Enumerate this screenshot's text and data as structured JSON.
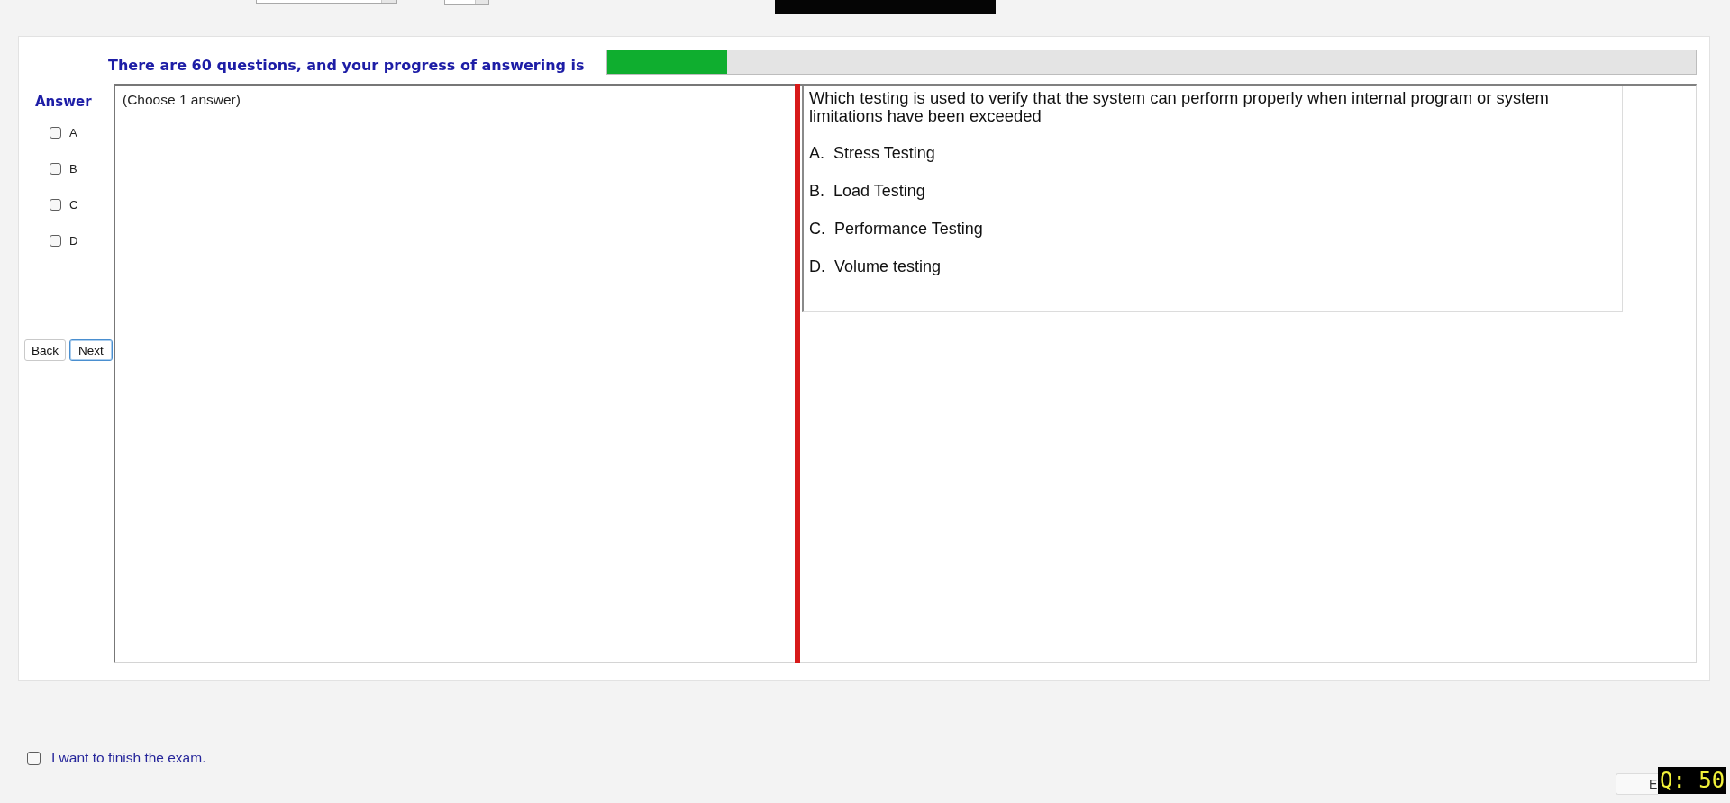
{
  "exam": {
    "progress": {
      "label": "There are 60 questions, and your progress of answering is",
      "level": 0.11
    },
    "answer_panel": {
      "title": "Answer",
      "options": [
        {
          "label": "A",
          "checked": false
        },
        {
          "label": "B",
          "checked": false
        },
        {
          "label": "C",
          "checked": false
        },
        {
          "label": "D",
          "checked": false
        }
      ],
      "buttons": [
        {
          "label": "Back",
          "focused": false
        },
        {
          "label": "Next",
          "focused": true
        }
      ]
    },
    "answer_box": {
      "value": "(Choose 1 answer)"
    },
    "question": {
      "text": "Which testing is used to verify that the system can perform properly when internal program or system limitations have been exceeded",
      "options": [
        "A.  Stress Testing",
        "B.  Load Testing",
        "C.  Performance Testing",
        "D.  Volume testing"
      ]
    }
  },
  "finish": {
    "label": "I want to finish the exam.",
    "checked": false
  },
  "footer": {
    "button": "E",
    "badge": "Q: 50"
  }
}
